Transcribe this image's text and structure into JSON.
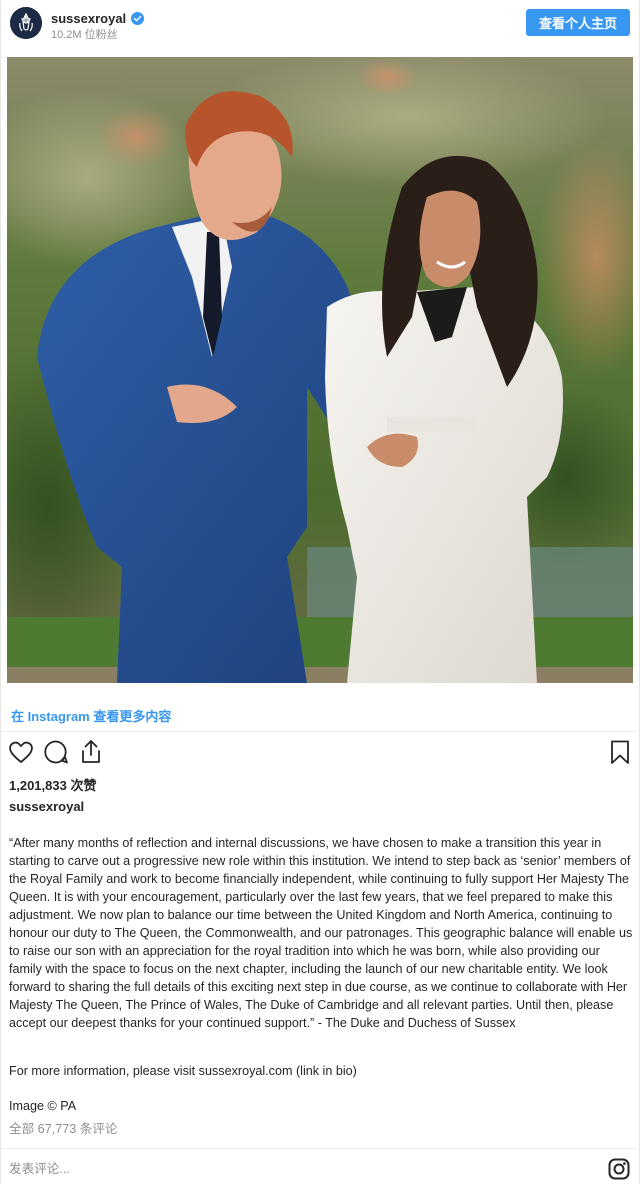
{
  "header": {
    "handle": "sussexroyal",
    "followers": "10.2M 位粉丝",
    "view_profile_label": "查看个人主页"
  },
  "photo": {
    "alt": "Photo of a man in a blue suit and a woman in a white coat walking arm in arm in a garden"
  },
  "more_link": "在 Instagram 查看更多内容",
  "actions": {
    "like_icon": "heart-icon",
    "comment_icon": "comment-icon",
    "share_icon": "share-icon",
    "save_icon": "bookmark-icon"
  },
  "likes": "1,201,833 次赞",
  "caption": {
    "handle": "sussexroyal",
    "text": "“After many months of reflection and internal discussions, we have chosen to make a transition this year in starting to carve out a progressive new role within this institution. We intend to step back as ‘senior’ members of the Royal Family and work to become financially independent, while continuing to fully support Her Majesty The Queen. It is with your encouragement, particularly over the last few years, that we feel prepared to make this adjustment. We now plan to balance our time between the United Kingdom and North America, continuing to honour our duty to The Queen, the Commonwealth, and our patronages. This geographic balance will enable us to raise our son with an appreciation for the royal tradition into which he was born, while also providing our family with the space to focus on the next chapter, including the launch of our new charitable entity. We look forward to sharing the full details of this exciting next step in due course, as we continue to collaborate with Her Majesty The Queen, The Prince of Wales, The Duke of Cambridge and all relevant parties. Until then, please accept our deepest thanks for your continued support.” - The Duke and Duchess of Sussex",
    "more_info": "For more information, please visit sussexroyal.com (link in bio)",
    "credit": "Image © PA"
  },
  "comments_count": "全部 67,773 条评论",
  "comment_box": {
    "placeholder": "发表评论..."
  },
  "colors": {
    "accent": "#3897f0",
    "text": "#262626",
    "muted": "#8e8e8e"
  }
}
